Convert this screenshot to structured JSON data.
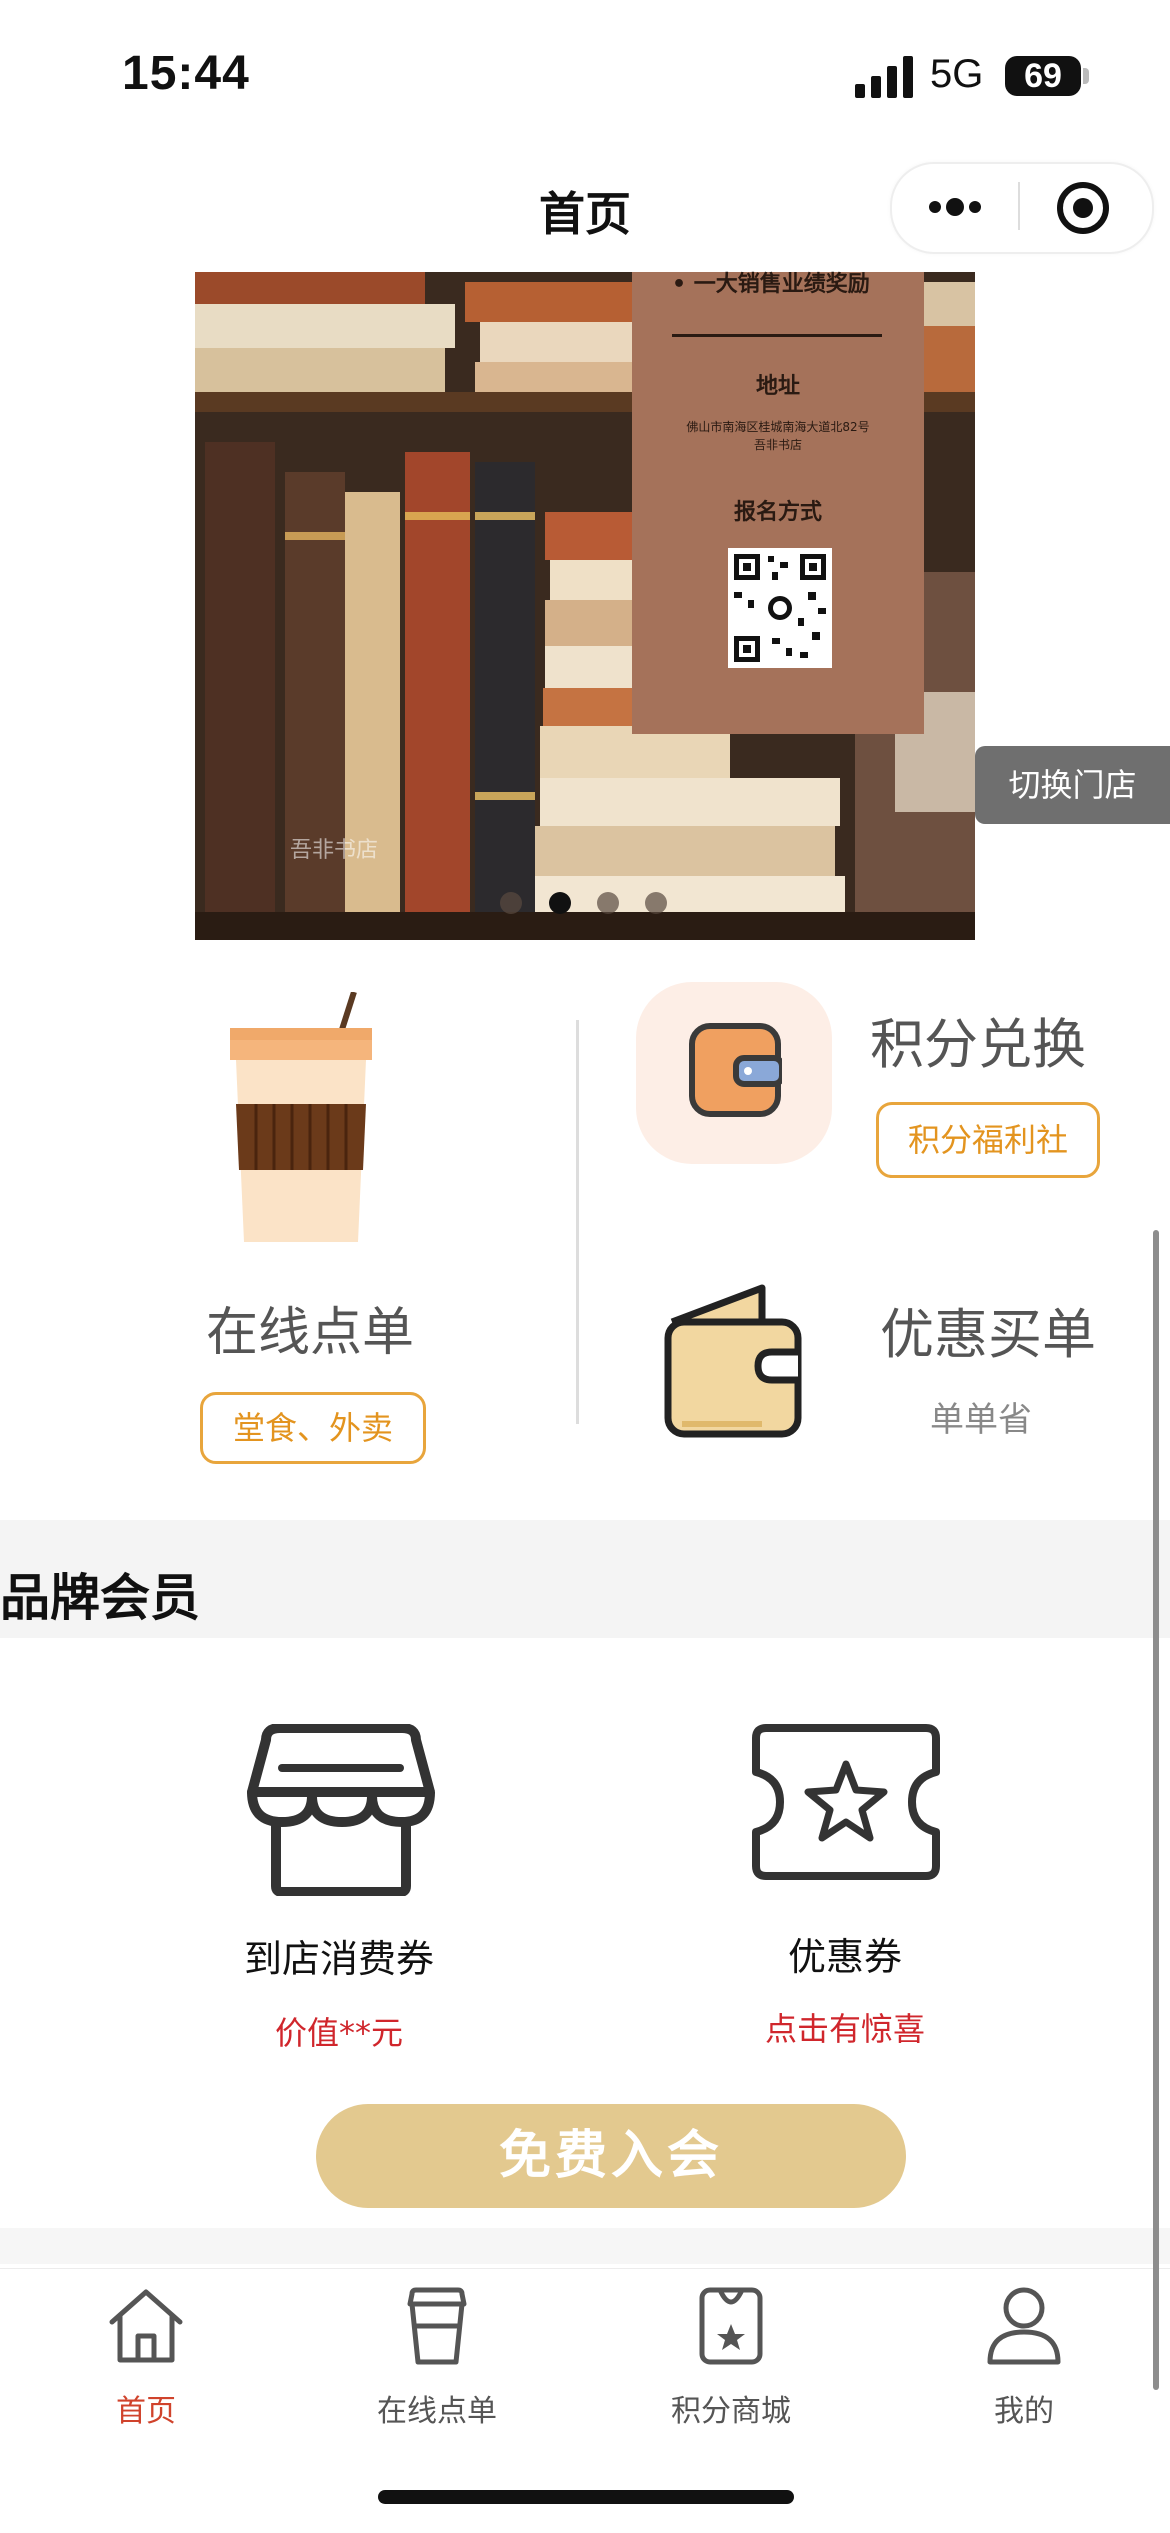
{
  "status_bar": {
    "time": "15:44",
    "network": "5G",
    "battery": "69"
  },
  "nav": {
    "title": "首页"
  },
  "banner": {
    "poster_line_top": "• 一大销售业绩奖励",
    "address_heading": "地址",
    "address_text": "佛山市南海区桂城南海大道北82号",
    "address_text2": "吾非书店",
    "signup_heading": "报名方式",
    "watermark": "吾非书店",
    "slide_count": 4,
    "active_slide": 2
  },
  "switch_store": "切换门店",
  "quick_actions": {
    "order": {
      "title": "在线点单",
      "tag": "堂食、外卖"
    },
    "points": {
      "title": "积分兑换",
      "tag": "积分福利社"
    },
    "discount": {
      "title": "优惠买单",
      "subtitle": "单单省"
    }
  },
  "brand_member": {
    "section_title": "品牌会员",
    "items": [
      {
        "label": "到店消费券",
        "value": "价值**元",
        "icon": "store-icon"
      },
      {
        "label": "优惠券",
        "value": "点击有惊喜",
        "icon": "star-ticket-icon"
      }
    ],
    "join_button": "免费入会"
  },
  "tabbar": {
    "items": [
      {
        "label": "首页",
        "icon": "home-icon",
        "active": true
      },
      {
        "label": "在线点单",
        "icon": "cup-icon",
        "active": false
      },
      {
        "label": "积分商城",
        "icon": "points-bag-icon",
        "active": false
      },
      {
        "label": "我的",
        "icon": "user-icon",
        "active": false
      }
    ]
  },
  "colors": {
    "accent_orange": "#e8a53c",
    "value_red": "#d0262c",
    "active_tab": "#d0432c",
    "join_button": "#e3c98f"
  }
}
